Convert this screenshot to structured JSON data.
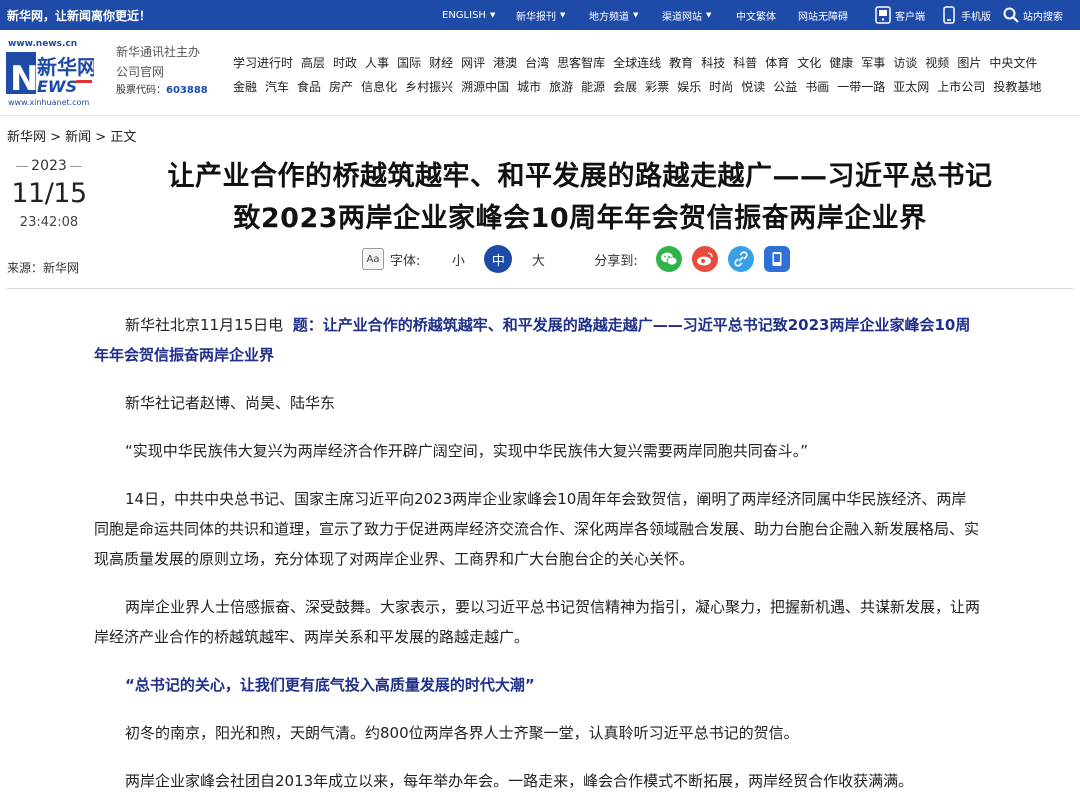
{
  "topbar": {
    "slogan": "新华网，让新闻离你更近！",
    "nav": [
      {
        "label": "ENGLISH",
        "caret": true
      },
      {
        "label": "新华报刊",
        "caret": true
      },
      {
        "label": "地方频道",
        "caret": true
      },
      {
        "label": "渠道网站",
        "caret": true
      },
      {
        "label": "中文繁体",
        "caret": false
      },
      {
        "label": "网站无障碍",
        "caret": false
      },
      {
        "label": "客户端",
        "icon": "app-icon"
      },
      {
        "label": "手机版",
        "icon": "mobile-icon"
      },
      {
        "label": "站内搜索",
        "icon": "search-icon"
      }
    ]
  },
  "header": {
    "logo_url_top": "www.news.cn",
    "logo_url_bottom": "www.xinhuanet.com",
    "org_line1": "新华通讯社主办",
    "org_line2": "公司官网",
    "stock_label": "股票代码：",
    "stock_code": "603888",
    "channels_row1": [
      "学习进行时",
      "高层",
      "时政",
      "人事",
      "国际",
      "财经",
      "网评",
      "港澳",
      "台湾",
      "思客智库",
      "全球连线",
      "教育",
      "科技",
      "科普",
      "体育",
      "文化",
      "健康",
      "军事",
      "访谈",
      "视频",
      "图片",
      "中央文件"
    ],
    "channels_row2": [
      "金融",
      "汽车",
      "食品",
      "房产",
      "信息化",
      "乡村振兴",
      "溯源中国",
      "城市",
      "旅游",
      "能源",
      "会展",
      "彩票",
      "娱乐",
      "时尚",
      "悦读",
      "公益",
      "书画",
      "一带一路",
      "亚太网",
      "上市公司",
      "投教基地"
    ]
  },
  "breadcrumb": "新华网 > 新闻 > 正文",
  "date": {
    "year": "2023",
    "month_day": "11/15",
    "time": "23:42:08"
  },
  "source": "来源：新华网",
  "title_line1": "让产业合作的桥越筑越牢、和平发展的路越走越广——习近平总书记",
  "title_line2": "致2023两岸企业家峰会10周年年会贺信振奋两岸企业界",
  "toolbar": {
    "font_icon_text": "Aa",
    "font_label": "字体:",
    "sizes": [
      "小",
      "中",
      "大"
    ],
    "active_size": "中",
    "share_label": "分享到:"
  },
  "article": {
    "dateline": "新华社北京11月15日电",
    "lead_title": "题：让产业合作的桥越筑越牢、和平发展的路越走越广——习近平总书记致2023两岸企业家峰会10周年年会贺信振奋两岸企业界",
    "byline": "新华社记者赵博、尚昊、陆华东",
    "p1": "“实现中华民族伟大复兴为两岸经济合作开辟广阔空间，实现中华民族伟大复兴需要两岸同胞共同奋斗。”",
    "p2": "14日，中共中央总书记、国家主席习近平向2023两岸企业家峰会10周年年会致贺信，阐明了两岸经济同属中华民族经济、两岸同胞是命运共同体的共识和道理，宣示了致力于促进两岸经济交流合作、深化两岸各领域融合发展、助力台胞台企融入新发展格局、实现高质量发展的原则立场，充分体现了对两岸企业界、工商界和广大台胞台企的关心关怀。",
    "p3": "两岸企业界人士倍感振奋、深受鼓舞。大家表示，要以习近平总书记贺信精神为指引，凝心聚力，把握新机遇、共谋新发展，让两岸经济产业合作的桥越筑越牢、两岸关系和平发展的路越走越广。",
    "subhead": "“总书记的关心，让我们更有底气投入高质量发展的时代大潮”",
    "p4": "初冬的南京，阳光和煦，天朗气清。约800位两岸各界人士齐聚一堂，认真聆听习近平总书记的贺信。",
    "p5": "两岸企业家峰会社团自2013年成立以来，每年举办年会。一路走来，峰会合作模式不断拓展，两岸经贸合作收获满满。"
  }
}
